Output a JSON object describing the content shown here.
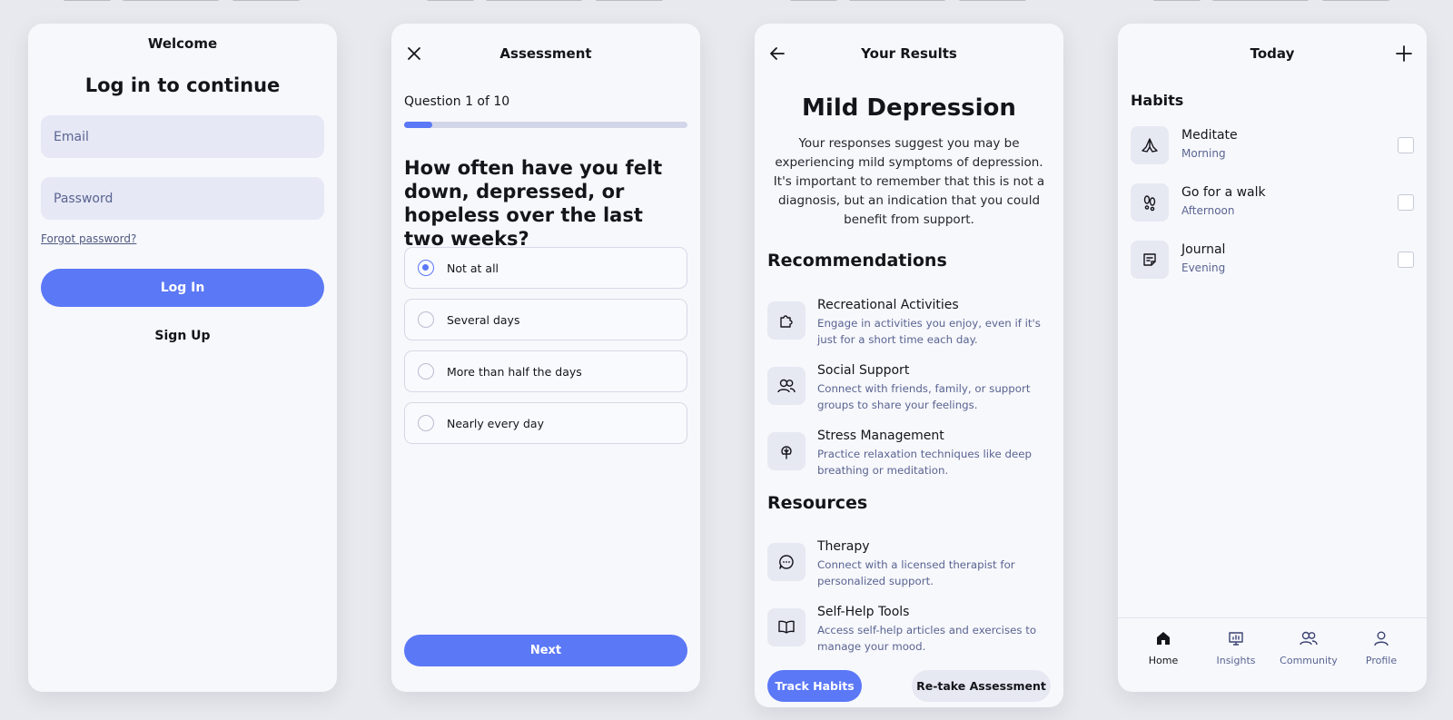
{
  "login": {
    "title": "Welcome",
    "heading": "Log in to continue",
    "email_placeholder": "Email",
    "password_placeholder": "Password",
    "forgot": "Forgot password?",
    "login_button": "Log In",
    "signup": "Sign Up"
  },
  "assessment": {
    "title": "Assessment",
    "question_count": "Question 1 of 10",
    "progress": 0.1,
    "question": "How often have you felt down, depressed, or hopeless over the last two weeks?",
    "options": [
      {
        "label": "Not at all",
        "selected": true
      },
      {
        "label": "Several days",
        "selected": false
      },
      {
        "label": "More than half the days",
        "selected": false
      },
      {
        "label": "Nearly every day",
        "selected": false
      }
    ],
    "next_button": "Next"
  },
  "results": {
    "title": "Your Results",
    "diagnosis": "Mild Depression",
    "description": "Your responses suggest you may be experiencing mild symptoms of depression. It's important to remember that this is not a diagnosis, but an indication that you could benefit from support.",
    "recommendations_title": "Recommendations",
    "recommendations": [
      {
        "title": "Recreational Activities",
        "desc": "Engage in activities you enjoy, even if it's just for a short time each day.",
        "icon": "puzzle-icon"
      },
      {
        "title": "Social Support",
        "desc": "Connect with friends, family, or support groups to share your feelings.",
        "icon": "users-icon"
      },
      {
        "title": "Stress Management",
        "desc": "Practice relaxation techniques like deep breathing or meditation.",
        "icon": "tree-icon"
      }
    ],
    "resources_title": "Resources",
    "resources": [
      {
        "title": "Therapy",
        "desc": "Connect with a licensed therapist for personalized support.",
        "icon": "chat-icon"
      },
      {
        "title": "Self-Help Tools",
        "desc": "Access self-help articles and exercises to manage your mood.",
        "icon": "book-icon"
      }
    ],
    "track_button": "Track Habits",
    "retake_button": "Re-take Assessment"
  },
  "today": {
    "title": "Today",
    "habits_title": "Habits",
    "habits": [
      {
        "title": "Meditate",
        "time": "Morning",
        "icon": "praying-hands-icon"
      },
      {
        "title": "Go for a walk",
        "time": "Afternoon",
        "icon": "footprints-icon"
      },
      {
        "title": "Journal",
        "time": "Evening",
        "icon": "note-icon"
      }
    ],
    "tabs": [
      {
        "label": "Home",
        "icon": "home-icon",
        "active": true
      },
      {
        "label": "Insights",
        "icon": "insights-icon",
        "active": false
      },
      {
        "label": "Community",
        "icon": "community-icon",
        "active": false
      },
      {
        "label": "Profile",
        "icon": "profile-icon",
        "active": false
      }
    ]
  },
  "colors": {
    "accent": "#5b78f6",
    "muted_text": "#5a6491",
    "card": "#f7f8fc",
    "background": "#e8e9ee"
  }
}
